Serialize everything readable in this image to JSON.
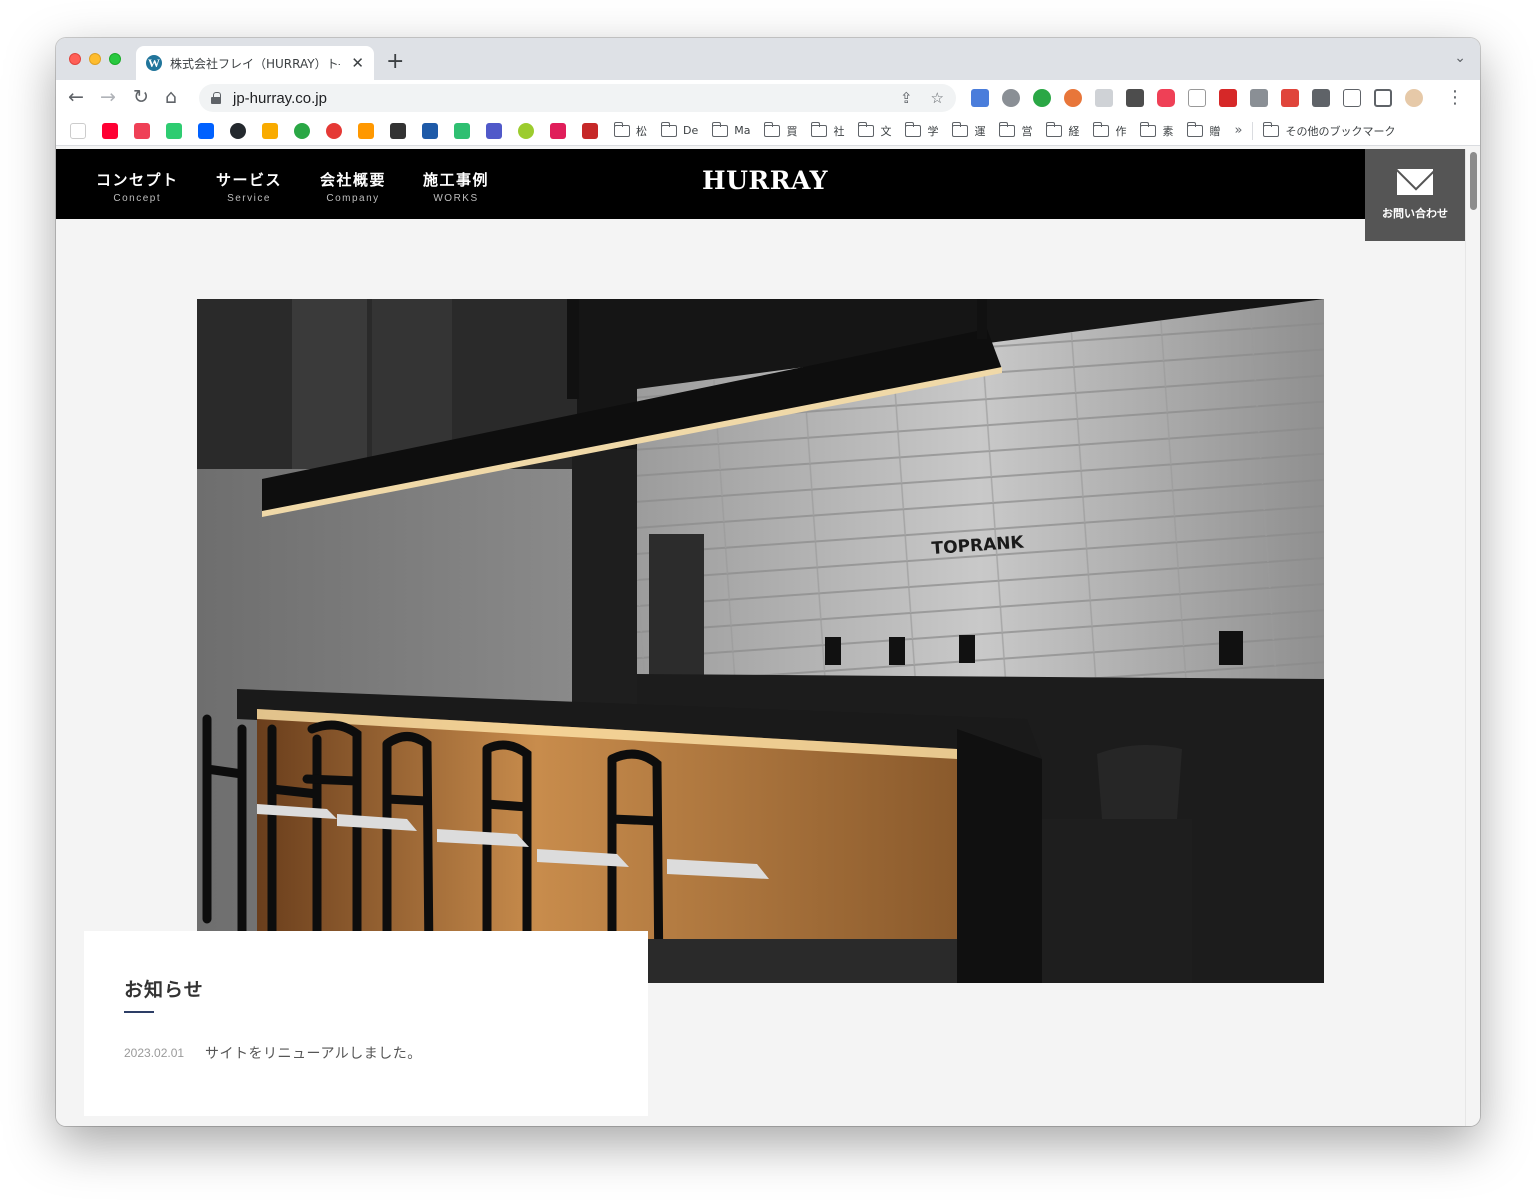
{
  "browser": {
    "tab_title": "株式会社フレイ（HURRAY）ト―",
    "tab_favicon": "wordpress-icon",
    "url": "jp-hurray.co.jp",
    "bookmarks": {
      "folders": [
        "松",
        "De",
        "Ma",
        "買",
        "社",
        "文",
        "学",
        "運",
        "営",
        "経",
        "作",
        "素",
        "贈"
      ],
      "more": "»",
      "other": "その他のブックマーク"
    }
  },
  "site": {
    "logo": "HURRAY",
    "nav": [
      {
        "jp": "コンセプト",
        "en": "Concept"
      },
      {
        "jp": "サービス",
        "en": "Service"
      },
      {
        "jp": "会社概要",
        "en": "Company"
      },
      {
        "jp": "施工事例",
        "en": "WORKS"
      }
    ],
    "contact_label": "お問い合わせ",
    "hero_sign": "TOPRANK",
    "news": {
      "title": "お知らせ",
      "items": [
        {
          "date": "2023.02.01",
          "text": "サイトをリニューアルしました。"
        }
      ]
    }
  },
  "colors": {
    "header_bg": "#000000",
    "contact_bg": "#555555",
    "page_bg": "#f4f4f4",
    "news_accent": "#2d3e66"
  }
}
